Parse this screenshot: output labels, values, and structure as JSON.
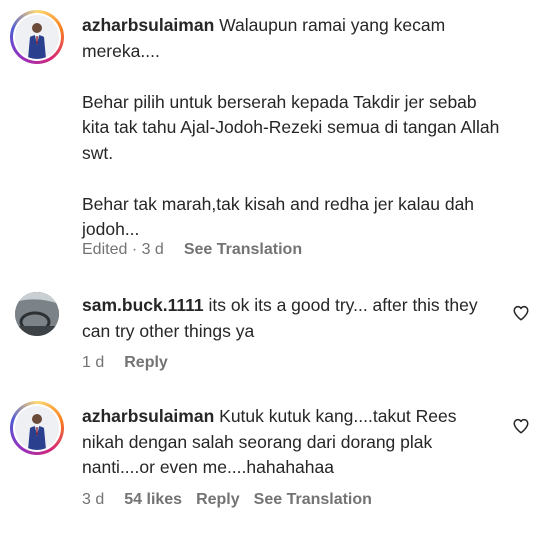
{
  "comments": [
    {
      "username": "azharbsulaiman",
      "paragraphs": [
        "Walaupun ramai yang kecam mereka....",
        "Behar pilih untuk berserah kepada Takdir jer sebab kita tak tahu Ajal-Jodoh-Rezeki semua di tangan Allah swt.",
        "Behar tak marah,tak kisah and redha jer kalau dah jodoh..."
      ],
      "time": "Edited · 3 d",
      "translate": "See Translation"
    },
    {
      "username": "sam.buck.1111",
      "text": "its ok its a good try... after this they can try other things ya",
      "time": "1 d",
      "reply": "Reply"
    },
    {
      "username": "azharbsulaiman",
      "text": "Kutuk kutuk kang....takut Rees nikah dengan salah seorang dari dorang plak nanti....or even me....hahahahaa",
      "time": "3 d",
      "likes": "54 likes",
      "reply": "Reply",
      "translate": "See Translation"
    }
  ],
  "icons": {
    "like": "heart-outline-icon",
    "avatar_1": "profile-photo-man-in-suit",
    "avatar_2": "profile-photo-car-interior",
    "avatar_3": "profile-photo-man-in-suit"
  }
}
